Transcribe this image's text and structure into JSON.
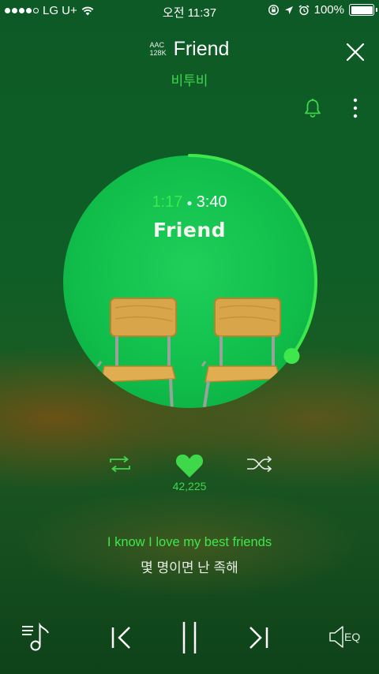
{
  "status_bar": {
    "carrier": "LG U+",
    "time": "오전 11:37",
    "battery": "100%",
    "signal_bars": 4
  },
  "header": {
    "quality_line1": "AAC",
    "quality_line2": "128K",
    "title": "Friend",
    "artist": "비투비"
  },
  "player": {
    "current_time": "1:17",
    "total_time": "3:40",
    "progress": 0.35,
    "album_title": "Friend",
    "accent_color": "#3ee84c"
  },
  "actions": {
    "like_count": "42,225"
  },
  "lyrics": {
    "current": "I know I love my best friends",
    "next": "몇 명이면 난 족해"
  },
  "controls": {
    "eq_label": "EQ"
  },
  "icons": [
    "wifi-icon",
    "rotation-lock-icon",
    "location-icon",
    "alarm-icon",
    "close-icon",
    "bell-icon",
    "more-icon",
    "repeat-icon",
    "heart-icon",
    "shuffle-icon",
    "playlist-icon",
    "previous-icon",
    "pause-icon",
    "next-icon",
    "eq-icon"
  ]
}
